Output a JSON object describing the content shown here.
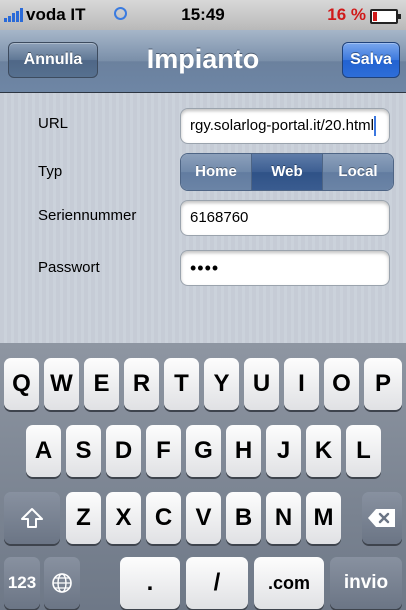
{
  "status_bar": {
    "carrier": "voda IT",
    "time": "15:49",
    "battery": "16 %",
    "battery_color": "#d01a1a"
  },
  "nav": {
    "title": "Impianto",
    "cancel_label": "Annulla",
    "save_label": "Salva"
  },
  "form": {
    "url_label": "URL",
    "url_value": "rgy.solarlog-portal.it/20.html",
    "type_label": "Typ",
    "type_options": [
      "Home",
      "Web",
      "Local"
    ],
    "type_selected": "Web",
    "serial_label": "Seriennummer",
    "serial_value": "6168760",
    "password_label": "Passwort",
    "password_value": "••••"
  },
  "keyboard": {
    "row1": [
      "Q",
      "W",
      "E",
      "R",
      "T",
      "Y",
      "U",
      "I",
      "O",
      "P"
    ],
    "row2": [
      "A",
      "S",
      "D",
      "F",
      "G",
      "H",
      "J",
      "K",
      "L"
    ],
    "row3": [
      "Z",
      "X",
      "C",
      "V",
      "B",
      "N",
      "M"
    ],
    "row4": {
      "numbers": "123",
      "dot": ".",
      "slash": "/",
      "com": ".com",
      "return": "invio"
    },
    "icons": [
      "shift-icon",
      "backspace-icon",
      "globe-icon"
    ]
  },
  "colors": {
    "nav_accent": "#6e86a5",
    "save_blue": "#2e6ed8",
    "segment_selected": "#3a5c90"
  }
}
